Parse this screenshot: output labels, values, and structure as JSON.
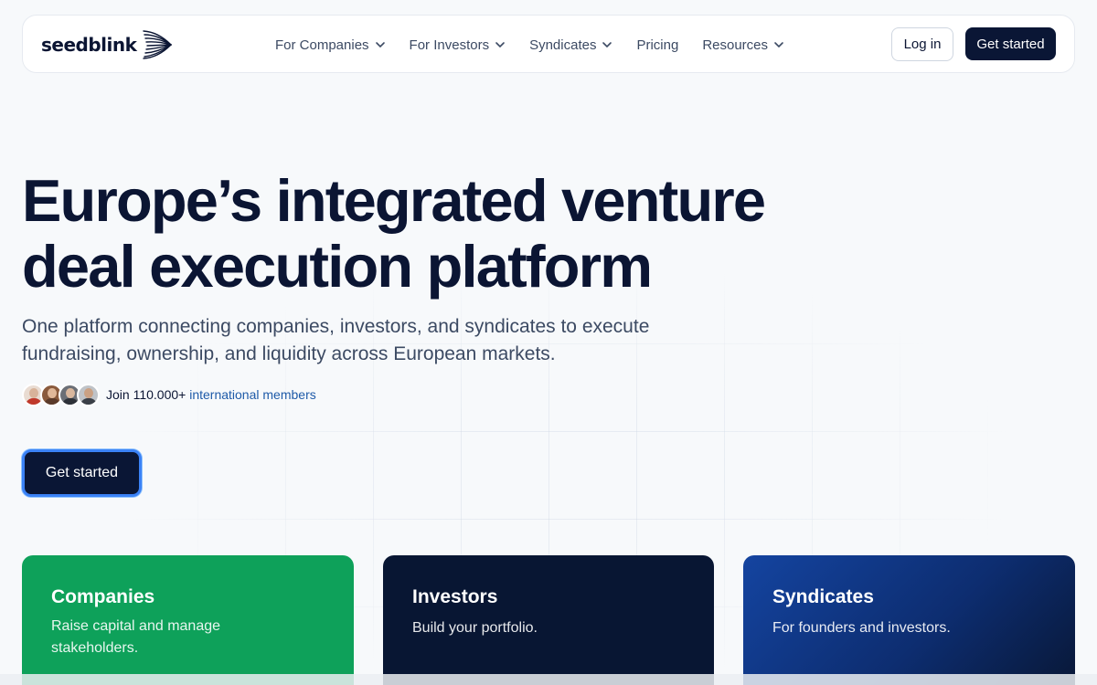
{
  "header": {
    "logo_text": "seedblink",
    "menu": [
      {
        "label": "For Companies",
        "has_dropdown": true
      },
      {
        "label": "For Investors",
        "has_dropdown": true
      },
      {
        "label": "Syndicates",
        "has_dropdown": true
      },
      {
        "label": "Pricing",
        "has_dropdown": false
      },
      {
        "label": "Resources",
        "has_dropdown": true
      }
    ],
    "login_label": "Log in",
    "get_started_label": "Get started"
  },
  "hero": {
    "title_line1": "Europe’s integrated venture",
    "title_line2": "deal execution platform",
    "subtitle_line1": "One platform connecting companies, investors, and syndicates to execute",
    "subtitle_line2": "fundraising, ownership, and liquidity across European markets.",
    "members_prefix": "Join 110.000+",
    "members_highlight": "international members",
    "cta_label": "Get started"
  },
  "cards": [
    {
      "title": "Companies",
      "description": "Raise capital and manage stakeholders.",
      "color": "#0ea15a"
    },
    {
      "title": "Investors",
      "description": "Build your portfolio.",
      "color": "#081633"
    },
    {
      "title": "Syndicates",
      "description": "For founders and investors.",
      "color": "#1444a0"
    }
  ],
  "colors": {
    "brand_dark": "#0a1635",
    "accent_blue": "#3b82f6",
    "background": "#f7f9fb"
  }
}
